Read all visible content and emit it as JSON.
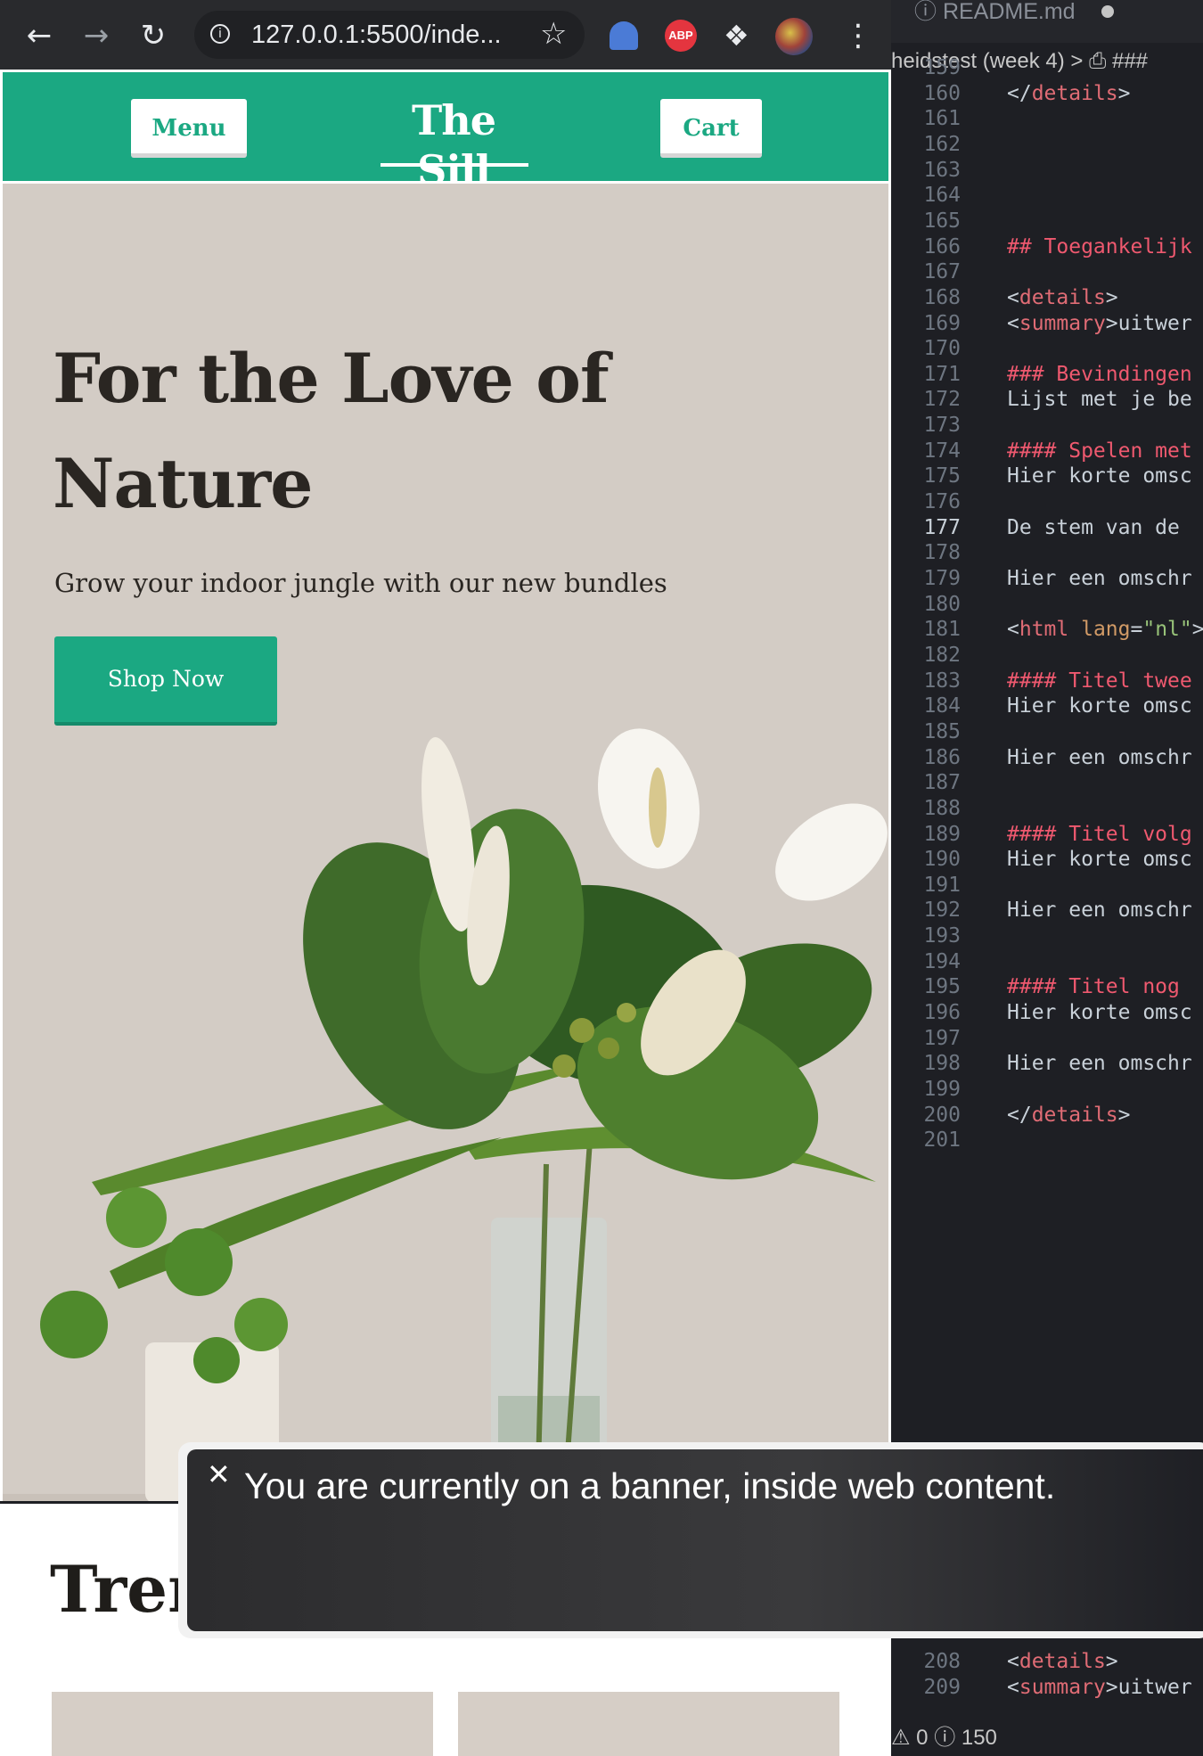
{
  "browser": {
    "back_icon": "arrow-left-icon",
    "forward_icon": "arrow-right-icon",
    "reload_icon": "reload-icon",
    "url": "127.0.0.1:5500/inde...",
    "extensions": [
      "ghost-extension-icon",
      "adblock-plus-icon",
      "puzzle-icon"
    ],
    "abp_label": "ABP"
  },
  "site": {
    "menu_label": "Menu",
    "logo": "The Sill",
    "cart_label": "Cart",
    "hero_title": "For the Love of Nature",
    "hero_subtitle": "Grow your indoor jungle with our new bundles",
    "cta_label": "Shop Now",
    "section_title": "Tren",
    "colors": {
      "brand": "#1ba882",
      "hero_bg": "#d3ccc5",
      "text": "#2a2622"
    }
  },
  "editor": {
    "tab_title": "README.md",
    "breadcrumb": "heidstest (week 4) > ⎙ ###",
    "lines": [
      {
        "n": "159",
        "code": ""
      },
      {
        "n": "160",
        "code": "</details>",
        "kind": "tag"
      },
      {
        "n": "161",
        "code": ""
      },
      {
        "n": "162",
        "code": ""
      },
      {
        "n": "163",
        "code": ""
      },
      {
        "n": "164",
        "code": ""
      },
      {
        "n": "165",
        "code": ""
      },
      {
        "n": "166",
        "code": "## Toegankelijk",
        "kind": "head"
      },
      {
        "n": "167",
        "code": ""
      },
      {
        "n": "168",
        "code": "<details>",
        "kind": "tag"
      },
      {
        "n": "169",
        "code": "<summary>uitwer",
        "kind": "tag"
      },
      {
        "n": "170",
        "code": ""
      },
      {
        "n": "171",
        "code": "### Bevindingen",
        "kind": "head"
      },
      {
        "n": "172",
        "code": "Lijst met je be",
        "kind": "text"
      },
      {
        "n": "173",
        "code": ""
      },
      {
        "n": "174",
        "code": "#### Spelen met",
        "kind": "head"
      },
      {
        "n": "175",
        "code": "Hier korte omsc",
        "kind": "text"
      },
      {
        "n": "176",
        "code": ""
      },
      {
        "n": "177",
        "code": "De stem van de",
        "kind": "text",
        "active": true
      },
      {
        "n": "178",
        "code": ""
      },
      {
        "n": "179",
        "code": "Hier een omschr",
        "kind": "text"
      },
      {
        "n": "180",
        "code": ""
      },
      {
        "n": "181",
        "code": "<html lang=\"nl\">",
        "kind": "html"
      },
      {
        "n": "182",
        "code": ""
      },
      {
        "n": "183",
        "code": "#### Titel twee",
        "kind": "head"
      },
      {
        "n": "184",
        "code": "Hier korte omsc",
        "kind": "text"
      },
      {
        "n": "185",
        "code": ""
      },
      {
        "n": "186",
        "code": "Hier een omschr",
        "kind": "text"
      },
      {
        "n": "187",
        "code": ""
      },
      {
        "n": "188",
        "code": ""
      },
      {
        "n": "189",
        "code": "#### Titel volg",
        "kind": "head"
      },
      {
        "n": "190",
        "code": "Hier korte omsc",
        "kind": "text"
      },
      {
        "n": "191",
        "code": ""
      },
      {
        "n": "192",
        "code": "Hier een omschr",
        "kind": "text"
      },
      {
        "n": "193",
        "code": ""
      },
      {
        "n": "194",
        "code": ""
      },
      {
        "n": "195",
        "code": "#### Titel nog",
        "kind": "head"
      },
      {
        "n": "196",
        "code": "Hier korte omsc",
        "kind": "text"
      },
      {
        "n": "197",
        "code": ""
      },
      {
        "n": "198",
        "code": "Hier een omschr",
        "kind": "text"
      },
      {
        "n": "199",
        "code": ""
      },
      {
        "n": "200",
        "code": "</details>",
        "kind": "tag"
      },
      {
        "n": "201",
        "code": ""
      }
    ],
    "lines_after": [
      {
        "n": "208",
        "code": "<details>",
        "kind": "tag"
      },
      {
        "n": "209",
        "code": "<summary>uitwer",
        "kind": "tag"
      }
    ],
    "status": "⚠ 0 ⓘ 150"
  },
  "voiceover": {
    "close_icon": "close-icon",
    "caption": "You are currently on a banner, inside web content."
  }
}
